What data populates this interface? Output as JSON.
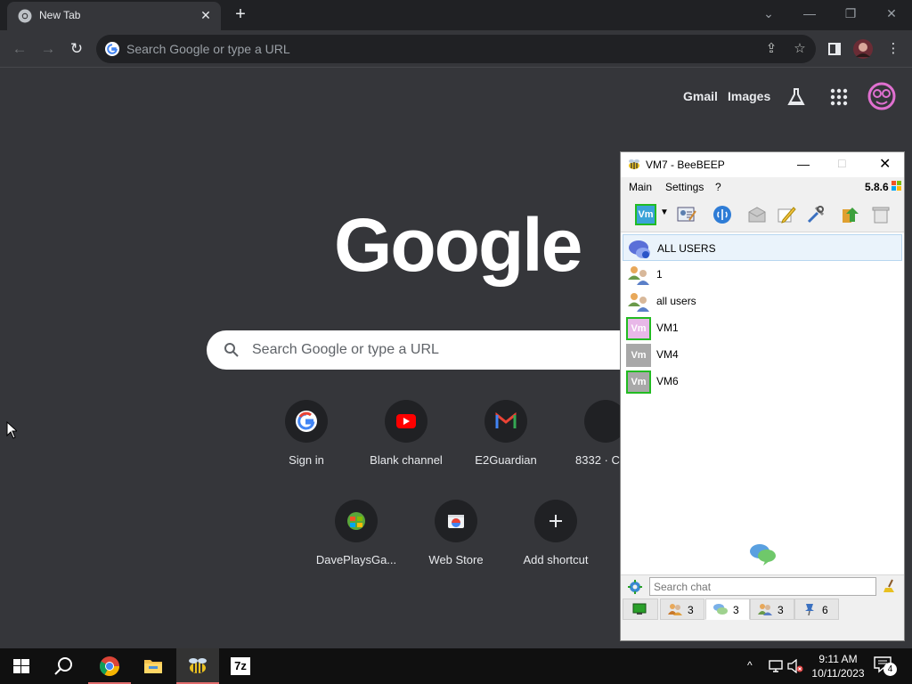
{
  "chrome": {
    "tab_title": "New Tab",
    "tab_close": "✕",
    "new_tab": "+",
    "omnibox_placeholder": "Search Google or type a URL",
    "window_controls": [
      "⌄",
      "—",
      "❐",
      "✕"
    ]
  },
  "ntp": {
    "top_links": [
      "Gmail",
      "Images"
    ],
    "logo": "Google",
    "search_placeholder": "Search Google or type a URL",
    "shortcuts": [
      {
        "label": "Sign in",
        "icon": "google-g-icon"
      },
      {
        "label": "Blank channel",
        "icon": "youtube-icon"
      },
      {
        "label": "E2Guardian",
        "icon": "gmail-icon"
      },
      {
        "label": "8332 · Cl",
        "icon": "generic-icon"
      },
      {
        "label": "DavePlaysGa...",
        "icon": "windows-xp-icon"
      },
      {
        "label": "Web Store",
        "icon": "web-store-icon"
      },
      {
        "label": "Add shortcut",
        "icon": "plus-icon"
      }
    ]
  },
  "beebeep": {
    "title": "VM7 - BeeBEEP",
    "menu": [
      "Main",
      "Settings",
      "?"
    ],
    "version": "5.8.6",
    "status_chip": "Vm",
    "users": [
      {
        "name": "ALL USERS",
        "type": "all"
      },
      {
        "name": "1",
        "type": "group"
      },
      {
        "name": "all users",
        "type": "group"
      },
      {
        "name": "VM1",
        "type": "vm"
      },
      {
        "name": "VM4",
        "type": "vm"
      },
      {
        "name": "VM6",
        "type": "vm"
      }
    ],
    "search_chat_placeholder": "Search chat",
    "tabs": [
      {
        "count": ""
      },
      {
        "count": "3"
      },
      {
        "count": "3"
      },
      {
        "count": "3"
      },
      {
        "count": "6"
      }
    ]
  },
  "taskbar": {
    "time": "9:11 AM",
    "date": "10/11/2023",
    "notifications": "4"
  },
  "colors": {
    "chrome_bg": "#35363a",
    "titlebar": "#202124",
    "accent_online": "#22bb22"
  }
}
